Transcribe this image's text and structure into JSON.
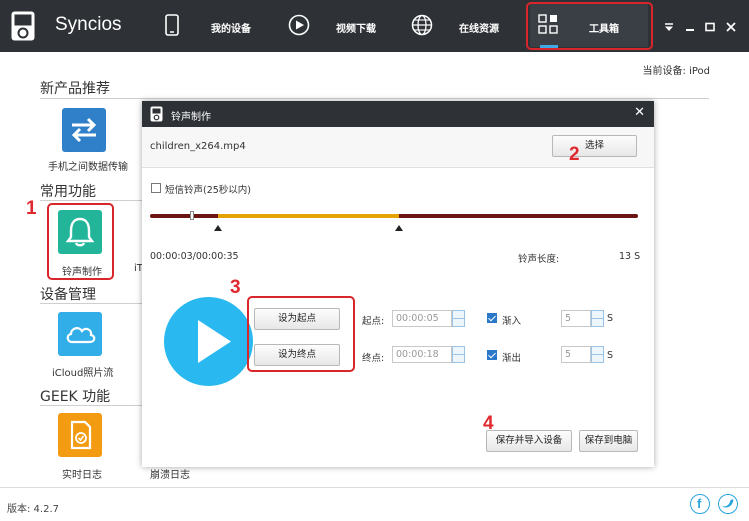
{
  "app": {
    "name": "Syncios",
    "version_label": "版本: 4.2.7",
    "current_device": "当前设备: iPod"
  },
  "nav": {
    "my_devices": "我的设备",
    "video_download": "视频下载",
    "online_resources": "在线资源",
    "toolbox": "工具箱"
  },
  "sections": {
    "new_products": "新产品推荐",
    "common": "常用功能",
    "device_mgmt": "设备管理",
    "geek": "GEEK 功能"
  },
  "apps": {
    "phone_transfer": "手机之间数据传输",
    "ringtone_maker": "铃声制作",
    "partial_label": "iT",
    "icloud_photos": "iCloud照片流",
    "realtime_log": "实时日志",
    "crash_log": "崩溃日志"
  },
  "dialog": {
    "title": "铃声制作",
    "filename": "children_x264.mp4",
    "choose_button": "选择",
    "sms_ringtone_label": "短信铃声(25秒以内)",
    "time_display": "00:00:03/00:00:35",
    "length_label": "铃声长度:",
    "length_value": "13 S",
    "set_start_button": "设为起点",
    "set_end_button": "设为终点",
    "start_label": "起点:",
    "end_label": "终点:",
    "start_time": "00:00:05",
    "end_time": "00:00:18",
    "fade_in_label": "渐入",
    "fade_out_label": "渐出",
    "fade_in_value": "5",
    "fade_out_value": "5",
    "seconds_unit": "S",
    "save_import_button": "保存并导入设备",
    "save_pc_button": "保存到电脑",
    "selection_start_fraction": 0.14,
    "selection_end_fraction": 0.51,
    "playhead_fraction": 0.086
  },
  "annotations": [
    "1",
    "2",
    "3",
    "4"
  ],
  "colors": {
    "topbar": "#2e3236",
    "accent_blue": "#29b8ef",
    "track_dark": "#6b1414",
    "track_selected": "#e4a300",
    "annotation_red": "#d9262b"
  },
  "icons": [
    "ipod-logo-icon",
    "phone-icon",
    "play-circle-icon",
    "globe-icon",
    "grid-icon",
    "transfer-arrows-icon",
    "bell-icon",
    "cloud-icon",
    "log-icon",
    "facebook-icon",
    "twitter-icon",
    "close-icon"
  ]
}
